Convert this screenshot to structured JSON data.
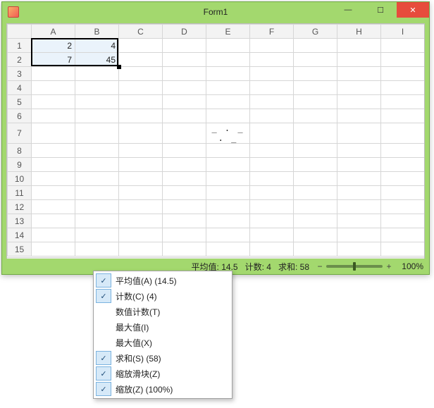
{
  "window": {
    "title": "Form1"
  },
  "columns": [
    "A",
    "B",
    "C",
    "D",
    "E",
    "F",
    "G",
    "H",
    "I"
  ],
  "rows": [
    "1",
    "2",
    "3",
    "4",
    "5",
    "6",
    "7",
    "8",
    "9",
    "10",
    "11",
    "12",
    "13",
    "14",
    "15"
  ],
  "cells": {
    "A1": "2",
    "B1": "4",
    "A2": "7",
    "B2": "45"
  },
  "row7_marks": "_ . _ . _",
  "selection": {
    "from": "A1",
    "to": "B2"
  },
  "status": {
    "avg_label": "平均值:",
    "avg_value": "14.5",
    "count_label": "计数:",
    "count_value": "4",
    "sum_label": "求和:",
    "sum_value": "58",
    "zoom_pct": "100%"
  },
  "context_menu": {
    "items": [
      {
        "checked": true,
        "label": "平均值(A) (14.5)"
      },
      {
        "checked": true,
        "label": "计数(C) (4)"
      },
      {
        "checked": false,
        "label": "数值计数(T)"
      },
      {
        "checked": false,
        "label": "最大值(I)"
      },
      {
        "checked": false,
        "label": "最大值(X)"
      },
      {
        "checked": true,
        "label": "求和(S) (58)"
      },
      {
        "checked": true,
        "label": "缩放滑块(Z)"
      },
      {
        "checked": true,
        "label": "缩放(Z) (100%)"
      }
    ]
  },
  "slider": {
    "minus": "−",
    "plus": "+"
  },
  "win_controls": {
    "min": "—",
    "max": "☐",
    "close": "✕"
  },
  "scroll": {
    "left": "◀",
    "right": "▶"
  }
}
